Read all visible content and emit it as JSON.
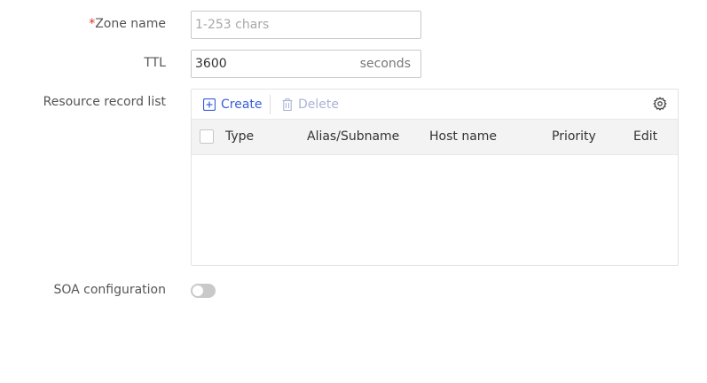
{
  "form": {
    "zone_name": {
      "required_mark": "*",
      "label": "Zone name",
      "value": "",
      "placeholder": "1-253 chars"
    },
    "ttl": {
      "label": "TTL",
      "value": "3600",
      "unit": "seconds"
    },
    "resource_record_list": {
      "label": "Resource record list",
      "toolbar": {
        "create_label": "Create",
        "delete_label": "Delete",
        "create_icon": "plus-square-icon",
        "delete_icon": "trash-icon",
        "settings_icon": "gear-icon"
      },
      "columns": [
        "Type",
        "Alias/Subname",
        "Host name",
        "Priority",
        "Edit"
      ],
      "rows": []
    },
    "soa_configuration": {
      "label": "SOA configuration",
      "enabled": false
    }
  },
  "colors": {
    "accent": "#3a5ed8",
    "required": "#e0301e",
    "disabled_text": "#a9b4d6",
    "header_bg": "#f3f3f3",
    "toggle_off": "#c9c9c9"
  }
}
